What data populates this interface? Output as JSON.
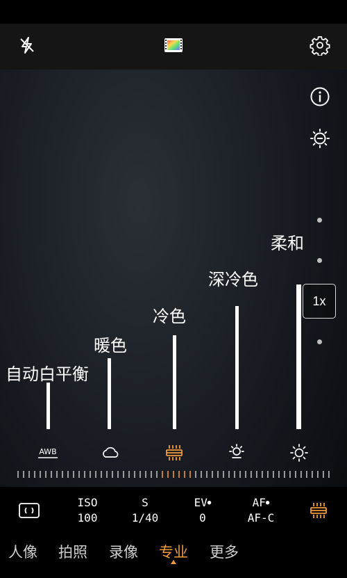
{
  "top_bar": {
    "flash_icon": "flash-off-icon",
    "filter_icon": "color-filter-icon",
    "settings_icon": "gear-icon"
  },
  "side": {
    "info_icon": "info-icon",
    "exposure_icon": "brightness-minus-icon",
    "zoom_label": "1x"
  },
  "white_balance": {
    "options": [
      {
        "label": "自动白平衡",
        "icon_text": "AWB",
        "icon": "awb-icon",
        "level": 0.32
      },
      {
        "label": "暖色",
        "icon": "cloudy-icon",
        "level": 0.49
      },
      {
        "label": "冷色",
        "icon": "fluorescent-icon",
        "level": 0.65,
        "selected": true
      },
      {
        "label": "深冷色",
        "icon": "incandescent-icon",
        "level": 0.85
      },
      {
        "label": "柔和",
        "icon": "daylight-icon",
        "level": 1.0
      }
    ]
  },
  "params": {
    "mode_icon": "metering-icon",
    "iso": {
      "name": "ISO",
      "value": "100"
    },
    "s": {
      "name": "S",
      "value": "1/40"
    },
    "ev": {
      "name": "EV",
      "value": "0"
    },
    "af": {
      "name": "AF",
      "value": "AF-C"
    },
    "wb_icon": "white-balance-fluorescent-icon"
  },
  "modes": {
    "items": [
      "人像",
      "拍照",
      "录像",
      "专业",
      "更多"
    ],
    "active": "专业"
  },
  "colors": {
    "accent": "#f29a38",
    "text": "#ffffff",
    "inactive_mode": "#cfcfcf"
  }
}
